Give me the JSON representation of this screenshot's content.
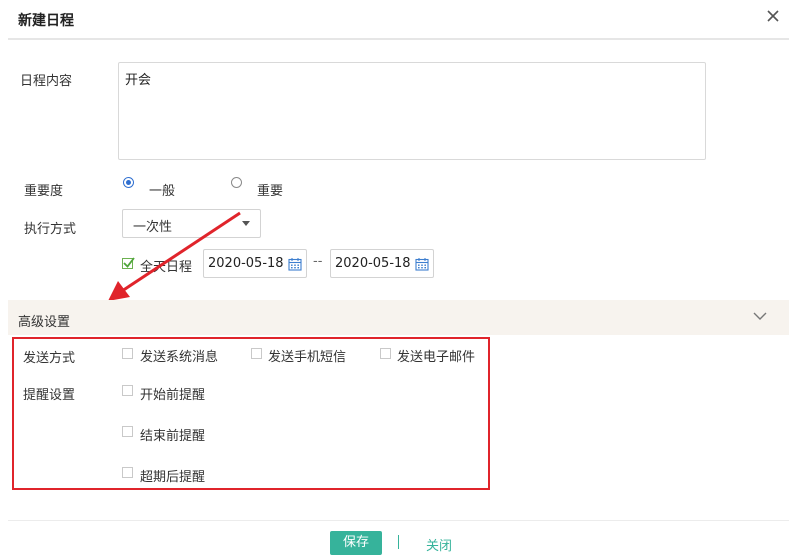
{
  "dialog": {
    "title": "新建日程",
    "close_icon": "close-icon"
  },
  "form": {
    "content_label": "日程内容",
    "content_value": "开会",
    "importance_label": "重要度",
    "importance_options": [
      {
        "label": "一般",
        "checked": true
      },
      {
        "label": "重要",
        "checked": false
      }
    ],
    "exec_label": "执行方式",
    "exec_value": "一次性",
    "allday_label": "全天日程",
    "allday_checked": true,
    "start_date": "2020-05-18",
    "date_separator": "--",
    "end_date": "2020-05-18"
  },
  "advanced": {
    "title": "高级设置",
    "send_label": "发送方式",
    "send_options": [
      "发送系统消息",
      "发送手机短信",
      "发送电子邮件"
    ],
    "remind_label": "提醒设置",
    "remind_options": [
      "开始前提醒",
      "结束前提醒",
      "超期后提醒"
    ]
  },
  "footer": {
    "save_label": "保存",
    "close_label": "关闭"
  },
  "colors": {
    "accent": "#36b39b",
    "radio_selected": "#2f6fd0",
    "annotation_red": "#e0242b",
    "section_bg": "#f7f3ee"
  }
}
